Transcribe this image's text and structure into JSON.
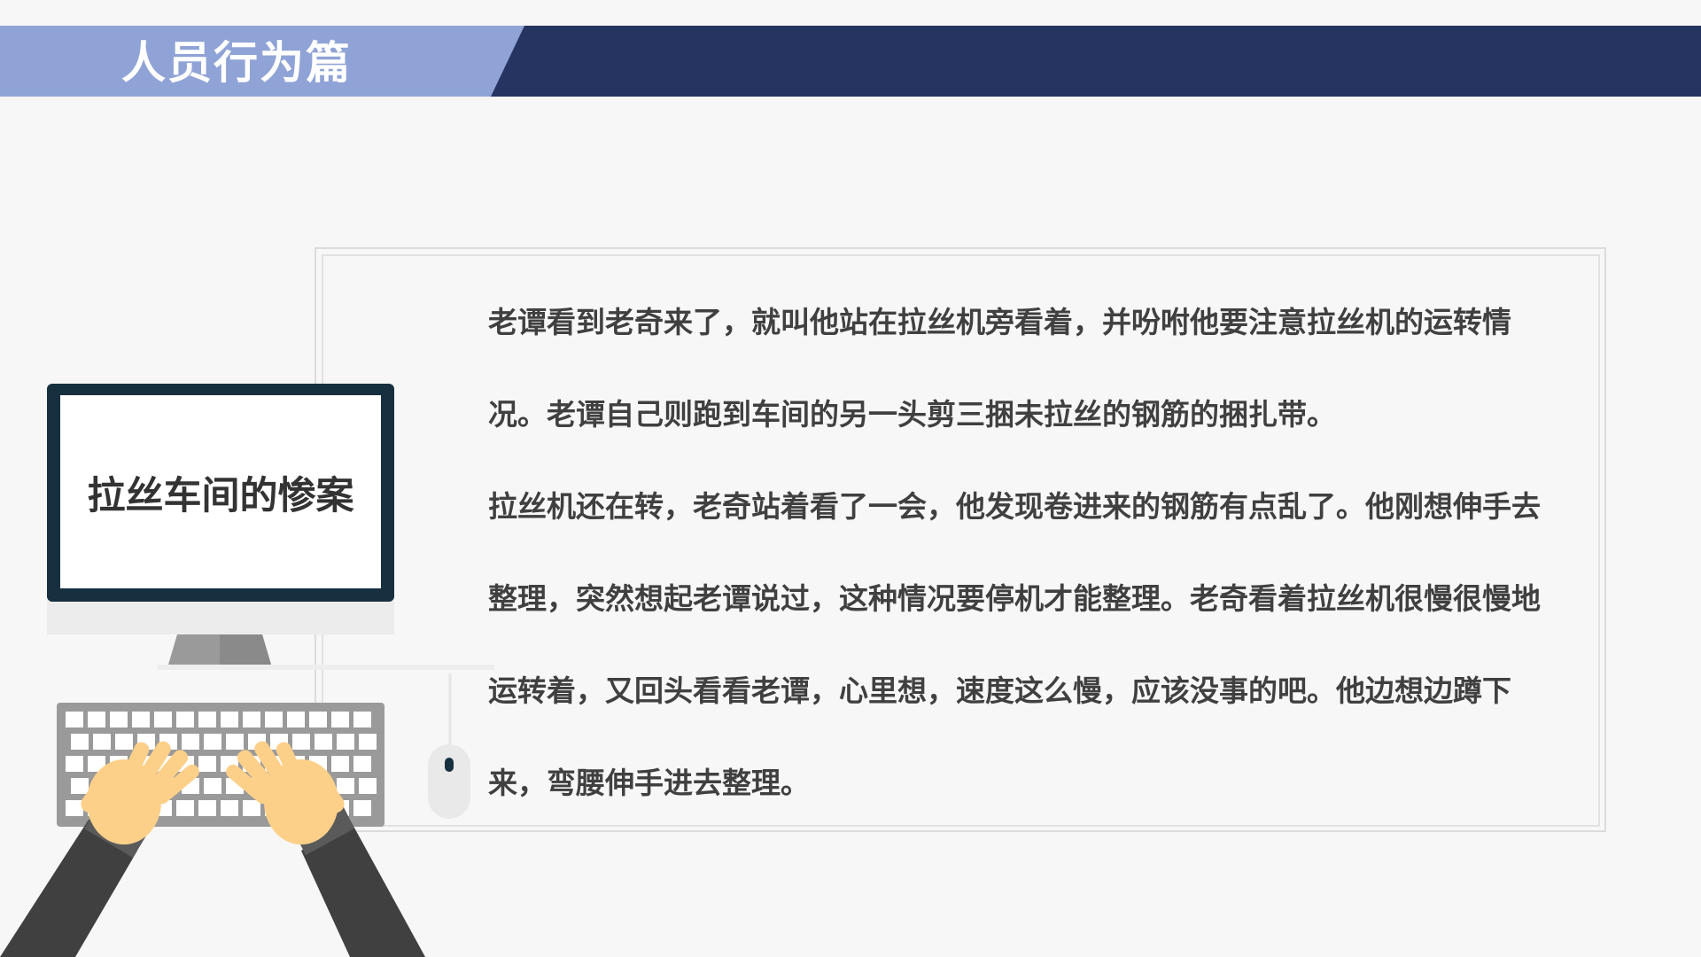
{
  "header": {
    "title": "人员行为篇",
    "accent_color": "#8fa3d6",
    "dark_color": "#263461"
  },
  "monitor": {
    "caption": "拉丝车间的惨案",
    "frame_color": "#163040"
  },
  "story": {
    "paragraphs": [
      "老谭看到老奇来了，就叫他站在拉丝机旁看着，并吩咐他要注意拉丝机的运转情况。老谭自己则跑到车间的另一头剪三捆未拉丝的钢筋的捆扎带。",
      "拉丝机还在转，老奇站着看了一会，他发现卷进来的钢筋有点乱了。他刚想伸手去整理，突然想起老谭说过，这种情况要停机才能整理。老奇看着拉丝机很慢很慢地运转着，又回头看看老谭，心里想，速度这么慢，应该没事的吧。他边想边蹲下来，弯腰伸手进去整理。"
    ]
  },
  "icons": {
    "monitor": "monitor-icon",
    "keyboard": "keyboard-icon",
    "mouse": "mouse-icon",
    "hands": "typing-hands-icon"
  }
}
